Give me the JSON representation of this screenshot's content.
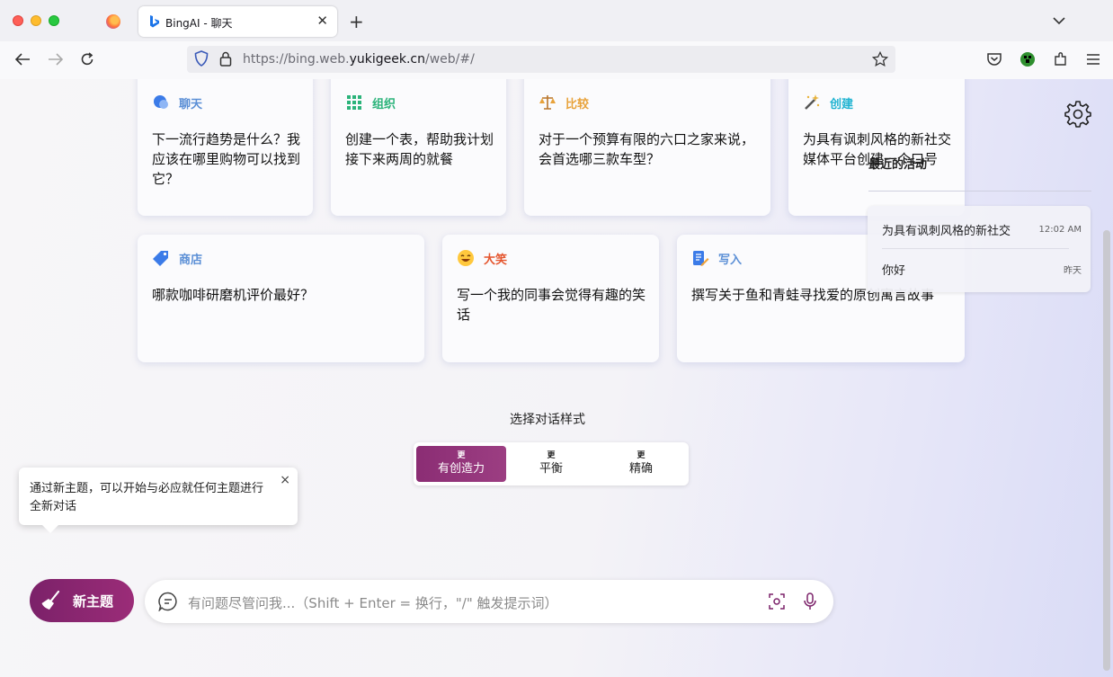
{
  "browser": {
    "tab_title": "BingAI - 聊天",
    "url_main": "https://bing.web.",
    "url_domain": "yukigeek.cn",
    "url_path": "/web/#/",
    "newtab_label": "+",
    "tab_close": "✕"
  },
  "cards": [
    {
      "label": "聊天",
      "label_color": "#5b8fd6",
      "text": "下一流行趋势是什么？我应该在哪里购物可以找到它？"
    },
    {
      "label": "组织",
      "label_color": "#2bb37a",
      "text": "创建一个表，帮助我计划接下来两周的就餐"
    },
    {
      "label": "比较",
      "label_color": "#e8a23a",
      "text": "对于一个预算有限的六口之家来说，会首选哪三款车型？"
    },
    {
      "label": "创建",
      "label_color": "#1fb3d1",
      "text": "为具有讽刺风格的新社交媒体平台创建一个口号"
    },
    {
      "label": "商店",
      "label_color": "#5b8fd6",
      "text": "哪款咖啡研磨机评价最好？"
    },
    {
      "label": "大笑",
      "label_color": "#e5552e",
      "text": "写一个我的同事会觉得有趣的笑话"
    },
    {
      "label": "写入",
      "label_color": "#5b8fd6",
      "text": "撰写关于鱼和青蛙寻找爱的原创寓言故事"
    }
  ],
  "recent": {
    "title": "最近的活动",
    "items": [
      {
        "title": "为具有讽刺风格的新社交",
        "time": "12:02 AM"
      },
      {
        "title": "你好",
        "time": "昨天"
      }
    ]
  },
  "style": {
    "label": "选择对话样式",
    "options": [
      {
        "more": "更",
        "name": "有创造力",
        "active": true
      },
      {
        "more": "更",
        "name": "平衡",
        "active": false
      },
      {
        "more": "更",
        "name": "精确",
        "active": false
      }
    ]
  },
  "tooltip": {
    "text": "通过新主题，可以开始与必应就任何主题进行全新对话",
    "close": "×"
  },
  "new_topic_label": "新主题",
  "input": {
    "placeholder": "有问题尽管问我...（Shift + Enter = 换行，\"/\" 触发提示词）"
  },
  "colors": {
    "accent": "#8b2d74",
    "page_bg_right": "#d9dbf6"
  }
}
